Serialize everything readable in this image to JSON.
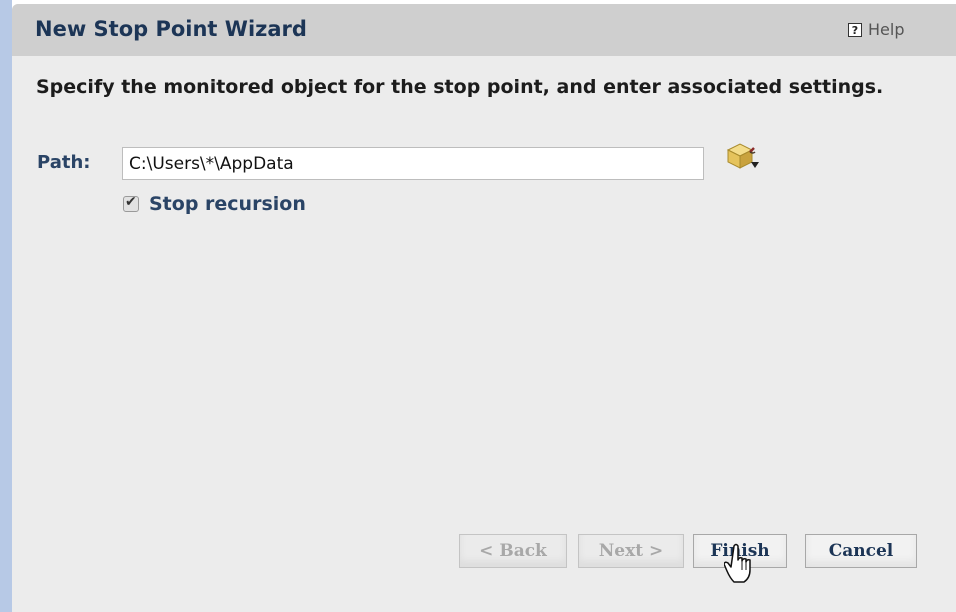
{
  "dialog": {
    "title": "New Stop Point Wizard",
    "help_label": "Help",
    "help_icon": "?",
    "instruction": "Specify the monitored object for the stop point, and enter associated settings."
  },
  "form": {
    "path_label": "Path:",
    "path_value": "C:\\Users\\*\\AppData",
    "browse_icon": "browse-object-icon",
    "stop_recursion_label": "Stop recursion",
    "stop_recursion_checked": true
  },
  "buttons": {
    "back": "< Back",
    "next": "Next >",
    "finish": "Finish",
    "cancel": "Cancel"
  },
  "colors": {
    "title_text": "#1c3556",
    "label_text": "#2a4466",
    "dialog_bg": "#ececec",
    "titlebar_bg": "#cfcfcf",
    "left_strip": "#b7c9e6"
  }
}
